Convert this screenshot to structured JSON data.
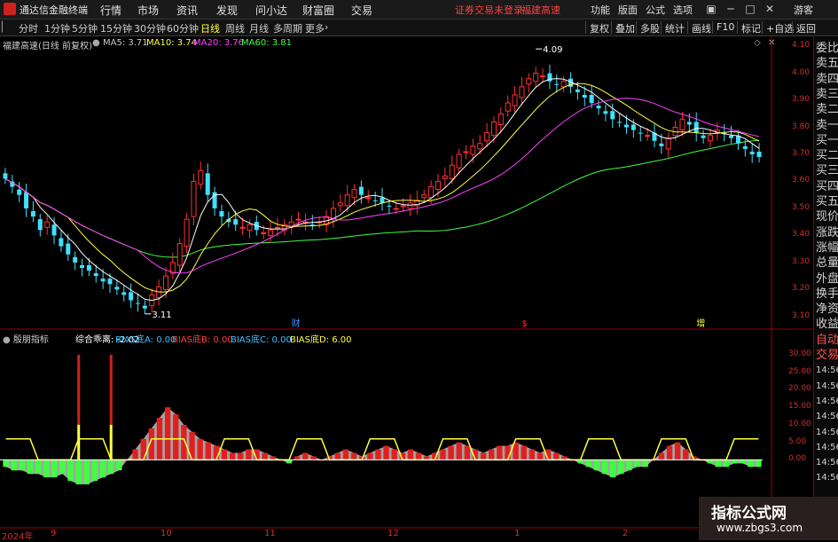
{
  "app": {
    "name": "通达信金融终端",
    "menu": [
      "行情",
      "市场",
      "资讯",
      "发现",
      "问小达",
      "财富圈",
      "交易"
    ],
    "status_notice": "证券交易未登录",
    "stock_name_header": "福建高速",
    "right_menu": [
      "功能",
      "版面",
      "公式",
      "选项"
    ],
    "user": "游客",
    "window_controls": [
      "▣",
      "─",
      "□",
      "✕"
    ]
  },
  "toolbar": {
    "periods": [
      "分时",
      "1分钟",
      "5分钟",
      "15分钟",
      "30分钟",
      "60分钟",
      "日线",
      "周线",
      "月线",
      "多周期",
      "更多"
    ],
    "active_period": "日线",
    "right_buttons": [
      "复权",
      "叠加",
      "多股",
      "统计",
      "画线",
      "F10",
      "标记",
      "+自选",
      "返回"
    ]
  },
  "main_chart": {
    "title": "福建高速(日线 前复权)",
    "ma": [
      {
        "label": "MA5: 3.71",
        "color": "#ffffff"
      },
      {
        "label": "MA10: 3.74",
        "color": "#ffff40"
      },
      {
        "label": "MA20: 3.76",
        "color": "#ff40ff"
      },
      {
        "label": "MA60: 3.81",
        "color": "#40ff40"
      }
    ],
    "high_label": "4.09",
    "low_label": "3.11",
    "event_labels": [
      "财",
      "$",
      "增"
    ],
    "y_ticks": [
      "4.10",
      "4.00",
      "3.90",
      "3.80",
      "3.70",
      "3.60",
      "3.50",
      "3.40",
      "3.30",
      "3.20",
      "3.10"
    ]
  },
  "indicator": {
    "name": "殷朋指标",
    "items": [
      {
        "label": "综合乖离: -2.02",
        "color": "#ffffff"
      },
      {
        "label": "BIAS底A: 0.00",
        "color": "#40c0ff"
      },
      {
        "label": "BIAS底B: 0.00",
        "color": "#ff4040"
      },
      {
        "label": "BIAS底C: 0.00",
        "color": "#40c0ff"
      },
      {
        "label": "BIAS底D: 6.00",
        "color": "#ffff40"
      }
    ],
    "y_ticks": [
      "30.00",
      "25.00",
      "20.00",
      "15.00",
      "10.00",
      "5.00",
      "0.00"
    ]
  },
  "x_axis": [
    "2024年",
    "9",
    "10",
    "11",
    "12",
    "1",
    "2"
  ],
  "side_panel": [
    "委比",
    "卖五",
    "卖四",
    "卖三",
    "卖二",
    "卖一",
    "买一",
    "买二",
    "买三",
    "买四",
    "买五",
    "现价",
    "涨跌",
    "涨幅",
    "总量",
    "外盘",
    "换手",
    "净资",
    "收益",
    "自动",
    "交易",
    "14:56",
    "14:56",
    "14:56",
    "14:56",
    "14:56",
    "14:56",
    "14:56",
    "14:56"
  ],
  "watermark": {
    "line1": "指标公式网",
    "line2": "www.zbgs3.com"
  },
  "colors": {
    "up": "#ff3030",
    "down": "#40e0ff",
    "ma5": "#ffffff",
    "ma10": "#ffff40",
    "ma20": "#ff40ff",
    "ma60": "#40ff40"
  },
  "chart_data": {
    "type": "candlestick",
    "price_range": [
      3.07,
      4.12
    ],
    "closes": [
      3.61,
      3.58,
      3.55,
      3.5,
      3.47,
      3.42,
      3.45,
      3.4,
      3.36,
      3.33,
      3.3,
      3.28,
      3.27,
      3.25,
      3.23,
      3.22,
      3.2,
      3.18,
      3.16,
      3.15,
      3.13,
      3.18,
      3.21,
      3.25,
      3.3,
      3.37,
      3.46,
      3.6,
      3.64,
      3.55,
      3.5,
      3.47,
      3.45,
      3.44,
      3.43,
      3.44,
      3.42,
      3.41,
      3.42,
      3.43,
      3.44,
      3.45,
      3.46,
      3.45,
      3.44,
      3.45,
      3.47,
      3.5,
      3.52,
      3.55,
      3.57,
      3.55,
      3.54,
      3.53,
      3.52,
      3.51,
      3.5,
      3.51,
      3.52,
      3.53,
      3.55,
      3.58,
      3.6,
      3.62,
      3.66,
      3.7,
      3.71,
      3.73,
      3.74,
      3.78,
      3.82,
      3.85,
      3.89,
      3.92,
      3.95,
      3.98,
      4.0,
      3.99,
      3.97,
      3.96,
      3.97,
      3.95,
      3.93,
      3.91,
      3.89,
      3.87,
      3.85,
      3.83,
      3.82,
      3.8,
      3.79,
      3.78,
      3.77,
      3.75,
      3.73,
      3.76,
      3.8,
      3.83,
      3.81,
      3.78,
      3.76,
      3.77,
      3.79,
      3.78,
      3.76,
      3.74,
      3.72,
      3.7,
      3.69
    ],
    "indicator_bias": [
      -2,
      -3,
      -3,
      -4,
      -4,
      -5,
      -5,
      -4,
      -6,
      -7,
      -7,
      -6,
      -5,
      -4,
      -3,
      0,
      3,
      6,
      9,
      12,
      15,
      13,
      10,
      8,
      6,
      5,
      4,
      3,
      2,
      2,
      3,
      3,
      2,
      1,
      0,
      -1,
      1,
      2,
      1,
      0,
      1,
      2,
      3,
      2,
      1,
      2,
      3,
      4,
      3,
      2,
      3,
      2,
      1,
      2,
      3,
      4,
      5,
      4,
      3,
      2,
      3,
      4,
      4,
      5,
      4,
      3,
      2,
      3,
      2,
      1,
      0,
      -1,
      -2,
      -3,
      -4,
      -5,
      -4,
      -3,
      -2,
      -2,
      0,
      2,
      4,
      5,
      3,
      1,
      0,
      -1,
      -2,
      -2,
      -1,
      -1,
      -2,
      -2
    ]
  }
}
